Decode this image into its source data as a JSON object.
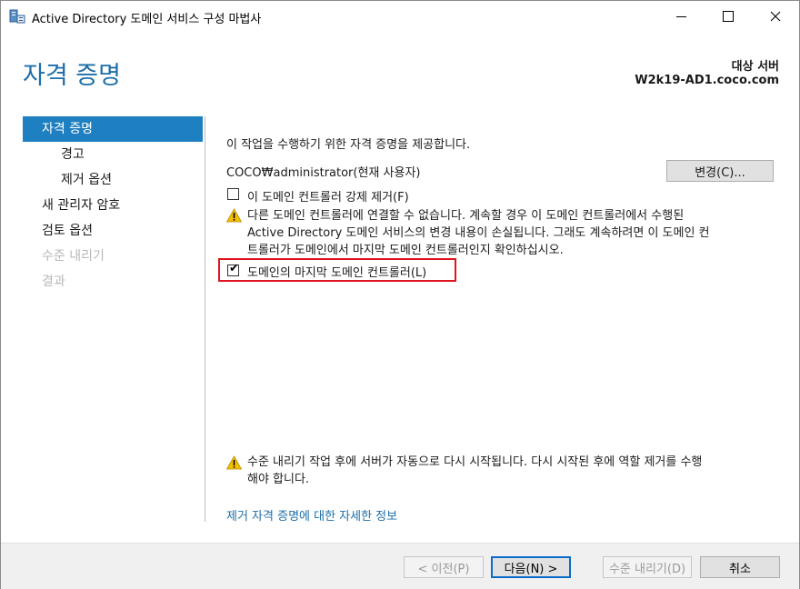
{
  "window": {
    "title": "Active Directory 도메인 서비스 구성 마법사"
  },
  "header": {
    "title": "자격 증명",
    "target_label": "대상 서버",
    "target_name": "W2k19-AD1.coco.com"
  },
  "nav": {
    "items": [
      {
        "label": "자격 증명",
        "state": "active"
      },
      {
        "label": "경고",
        "state": "normal"
      },
      {
        "label": "제거 옵션",
        "state": "normal"
      },
      {
        "label": "새 관리자 암호",
        "state": "normal"
      },
      {
        "label": "검토 옵션",
        "state": "normal"
      },
      {
        "label": "수준 내리기",
        "state": "disabled"
      },
      {
        "label": "결과",
        "state": "disabled"
      }
    ]
  },
  "content": {
    "intro": "이 작업을 수행하기 위한 자격 증명을 제공합니다.",
    "credential": "COCO₩administrator(현재 사용자)",
    "change_button": "변경(C)...",
    "force_remove": {
      "label": "이 도메인 컨트롤러 강제 제거(F)",
      "checked": false
    },
    "warning_lines": [
      "다른 도메인 컨트롤러에 연결할 수 없습니다. 계속할 경우 이 도메인 컨트롤러에서 수행된",
      "Active Directory 도메인 서비스의 변경 내용이 손실됩니다. 그래도 계속하려면 이 도메인 컨",
      "트롤러가 도메인에서 마지막 도메인 컨트롤러인지 확인하십시오."
    ],
    "last_dc": {
      "label": "도메인의 마지막 도메인 컨트롤러(L)",
      "checked": true
    },
    "restart_warning_lines": [
      "수준 내리기 작업 후에 서버가 자동으로 다시 시작됩니다. 다시 시작된 후에 역할 제거를 수행",
      "해야 합니다."
    ],
    "more_info_link": "제거 자격 증명에 대한 자세한 정보"
  },
  "footer": {
    "prev": "< 이전(P)",
    "next": "다음(N) >",
    "demote": "수준 내리기(D)",
    "cancel": "취소"
  },
  "colors": {
    "accent": "#1e6ea8",
    "nav_active": "#1e7fc1",
    "highlight": "#e0141e",
    "warning": "#f5c000"
  }
}
